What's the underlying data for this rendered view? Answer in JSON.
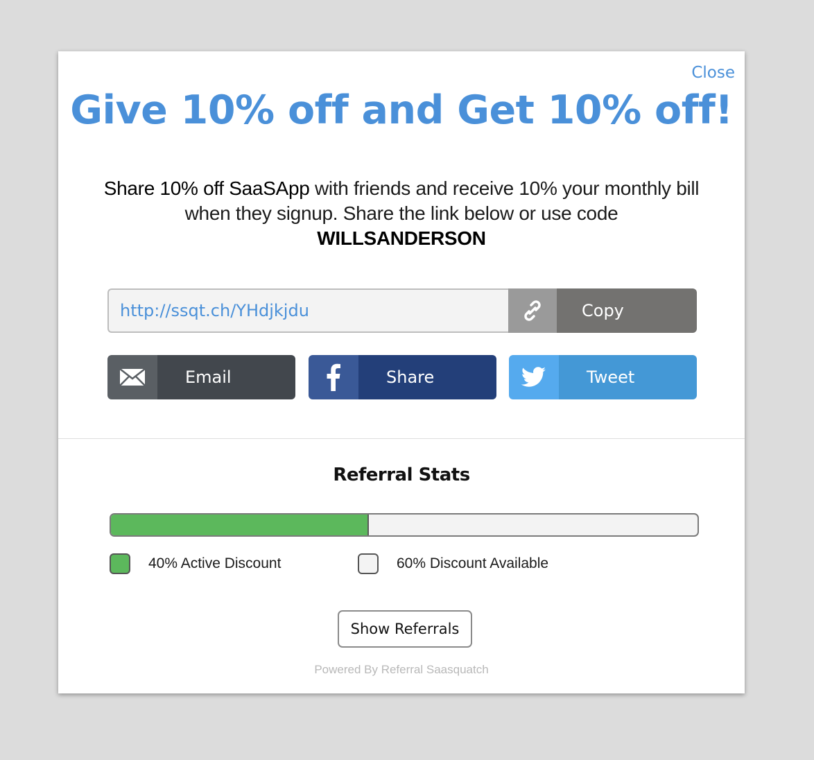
{
  "close_label": "Close",
  "headline": "Give 10% off and Get 10% off!",
  "description": {
    "lead": "Share 10% off SaaSApp",
    "rest": " with friends and receive 10% your monthly bill when they signup. Share the link below or use code",
    "code": "WILLSANDERSON"
  },
  "share_link": {
    "url": "http://ssqt.ch/YHdjkjdu",
    "link_icon": "link-icon",
    "copy_label": "Copy"
  },
  "share_buttons": {
    "email": {
      "label": "Email",
      "icon": "envelope-icon"
    },
    "facebook": {
      "label": "Share",
      "icon": "facebook-icon"
    },
    "twitter": {
      "label": "Tweet",
      "icon": "twitter-icon"
    }
  },
  "stats": {
    "title": "Referral Stats",
    "active_fraction": 0.44,
    "active_label": "40% Active Discount",
    "available_label": "60% Discount Available"
  },
  "show_referrals_label": "Show Referrals",
  "powered_by": "Powered By Referral Saasquatch",
  "colors": {
    "accent": "#4a90d9",
    "active_green": "#5cb85c",
    "email": "#42474d",
    "facebook": "#233f79",
    "twitter": "#4498d6"
  }
}
